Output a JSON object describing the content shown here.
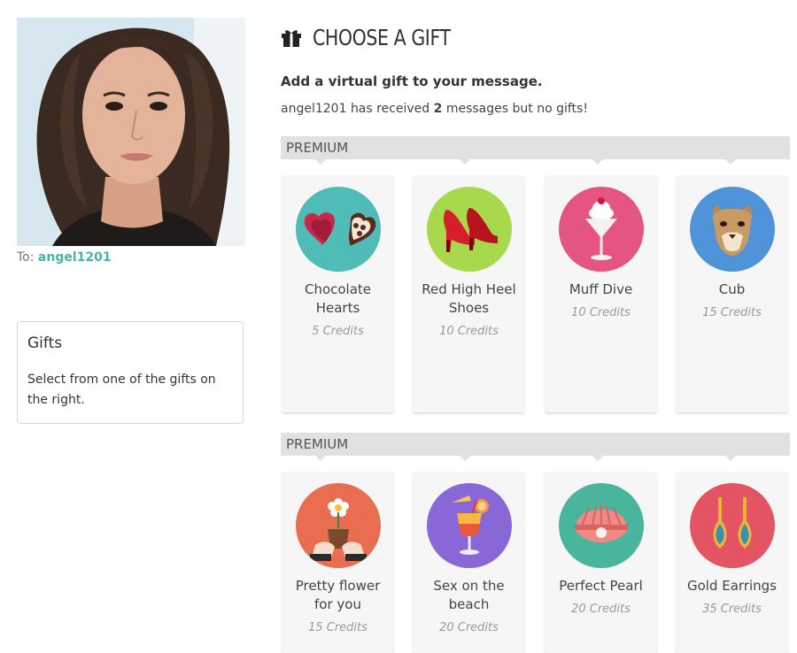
{
  "recipient": {
    "to_label": "To:",
    "username": "angel1201"
  },
  "info": {
    "title": "Gifts",
    "text": "Select from one of the gifts on the right."
  },
  "header": {
    "title": "CHOOSE A GIFT",
    "icon": "gift-icon"
  },
  "subtitle": "Add a virtual gift to your message.",
  "received": {
    "user": "angel1201",
    "pre": "has received",
    "count": "2",
    "post": "messages but no gifts!"
  },
  "sections": [
    {
      "label": "PREMIUM",
      "gifts": [
        {
          "name": "Chocolate Hearts",
          "credits": "5 Credits",
          "icon": "chocolate-hearts-icon",
          "color": "#4fbcb8"
        },
        {
          "name": "Red High Heel Shoes",
          "credits": "10 Credits",
          "icon": "red-shoes-icon",
          "color": "#a8d94c"
        },
        {
          "name": "Muff Dive",
          "credits": "10 Credits",
          "icon": "cocktail-icon",
          "color": "#e4557f"
        },
        {
          "name": "Cub",
          "credits": "15 Credits",
          "icon": "cougar-icon",
          "color": "#4f93d9"
        }
      ]
    },
    {
      "label": "PREMIUM",
      "gifts": [
        {
          "name": "Pretty flower for you",
          "credits": "15 Credits",
          "icon": "flower-pot-icon",
          "color": "#e96d51"
        },
        {
          "name": "Sex on the beach",
          "credits": "20 Credits",
          "icon": "beach-cocktail-icon",
          "color": "#8a67d6"
        },
        {
          "name": "Perfect Pearl",
          "credits": "20 Credits",
          "icon": "pearl-shell-icon",
          "color": "#4ab59d"
        },
        {
          "name": "Gold Earrings",
          "credits": "35 Credits",
          "icon": "earrings-icon",
          "color": "#e45463"
        }
      ]
    }
  ]
}
